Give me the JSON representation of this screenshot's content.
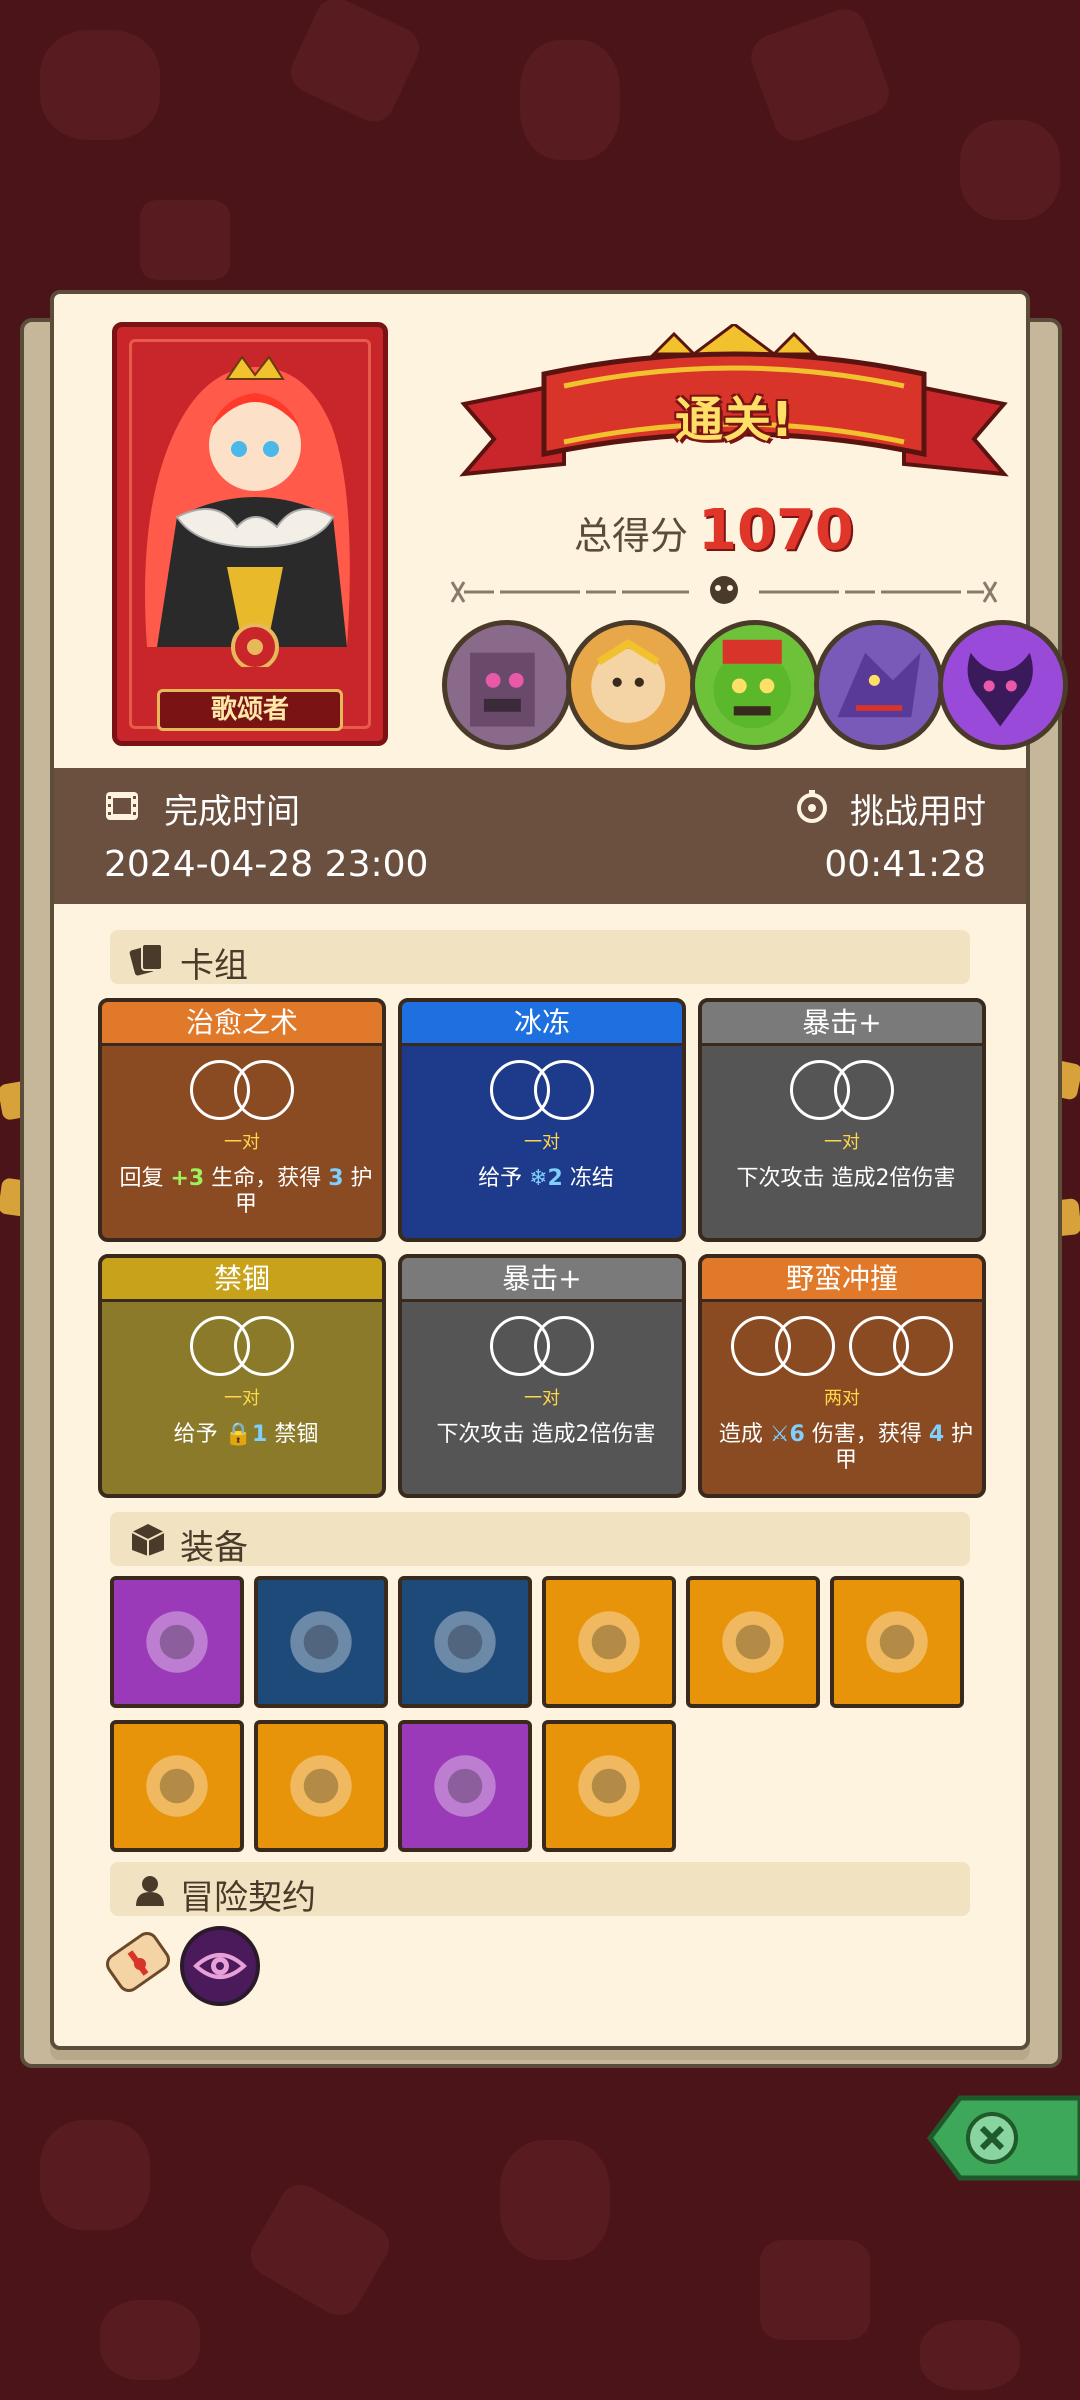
{
  "hero": {
    "name": "歌颂者"
  },
  "banner": {
    "title": "通关!"
  },
  "score": {
    "label": "总得分",
    "value": "1070"
  },
  "bosses": [
    {
      "icon": "stone-golem-boss-icon",
      "color": "#8a6a8a"
    },
    {
      "icon": "monkey-king-boss-icon",
      "color": "#e8a84a"
    },
    {
      "icon": "green-demon-boss-icon",
      "color": "#6ec23a"
    },
    {
      "icon": "purple-dragon-boss-icon",
      "color": "#7a5ab8"
    },
    {
      "icon": "shadow-demon-boss-icon",
      "color": "#9a4ad8"
    }
  ],
  "info": {
    "finish_label": "完成时间",
    "finish_value": "2024-04-28 23:00",
    "duration_label": "挑战用时",
    "duration_value": "00:41:28"
  },
  "deck": {
    "title": "卡组",
    "cards": [
      {
        "name": "治愈之术",
        "count": "一对",
        "desc": [
          "回复 ",
          "+3",
          " 生命，获得 ",
          "3",
          " 护甲"
        ],
        "head_color": "#e07a2a",
        "body_color": "#8a4a22"
      },
      {
        "name": "冰冻",
        "count": "一对",
        "desc": [
          "给予 ",
          "❄2",
          " 冻结"
        ],
        "head_color": "#1e6fe0",
        "body_color": "#1e3a8a"
      },
      {
        "name": "暴击+",
        "count": "一对",
        "desc": [
          "下次攻击 造成2倍伤害"
        ],
        "head_color": "#7a7a7a",
        "body_color": "#555555"
      },
      {
        "name": "禁锢",
        "count": "一对",
        "desc": [
          "给予 ",
          "🔒1",
          " 禁锢"
        ],
        "head_color": "#c8a21a",
        "body_color": "#8a7a2a"
      },
      {
        "name": "暴击+",
        "count": "一对",
        "desc": [
          "下次攻击 造成2倍伤害"
        ],
        "head_color": "#7a7a7a",
        "body_color": "#555555"
      },
      {
        "name": "野蛮冲撞",
        "count": "两对",
        "desc": [
          "造成 ",
          "⚔6",
          " 伤害，获得 ",
          "4",
          " 护甲"
        ],
        "head_color": "#e07a2a",
        "body_color": "#8a4a22"
      }
    ]
  },
  "equipment": {
    "title": "装备",
    "items": [
      {
        "icon": "purple-armor-icon",
        "bg": "#9a3ab8"
      },
      {
        "icon": "totem-mask-icon",
        "bg": "#1e4a7a"
      },
      {
        "icon": "golden-helmet-icon",
        "bg": "#1e4a7a"
      },
      {
        "icon": "lion-belt-icon",
        "bg": "#e8940a"
      },
      {
        "icon": "dark-ring-icon",
        "bg": "#e8940a"
      },
      {
        "icon": "orange-sweater-icon",
        "bg": "#e8940a"
      },
      {
        "icon": "golden-crown-icon",
        "bg": "#e8940a"
      },
      {
        "icon": "crystal-shield-icon",
        "bg": "#e8940a"
      },
      {
        "icon": "dark-potion-icon",
        "bg": "#9a3ab8"
      },
      {
        "icon": "coin-pouch-icon",
        "bg": "#e8940a"
      }
    ]
  },
  "contract": {
    "title": "冒险契约",
    "items": [
      "scroll-icon",
      "eye-rune-icon"
    ]
  }
}
